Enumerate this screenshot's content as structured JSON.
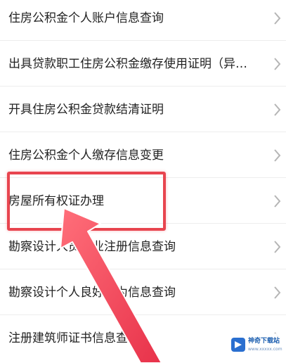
{
  "list": {
    "items": [
      {
        "label": "住房公积金个人账户信息查询"
      },
      {
        "label": "出具贷款职工住房公积金缴存使用证明（异…"
      },
      {
        "label": "开具住房公积金贷款结清证明"
      },
      {
        "label": "住房公积金个人缴存信息变更"
      },
      {
        "label": "房屋所有权证办理"
      },
      {
        "label": "勘察设计人员执业注册信息查询"
      },
      {
        "label": "勘察设计个人良好行为信息查询"
      },
      {
        "label": "注册建筑师证书信息查询"
      }
    ]
  },
  "icons": {
    "chevron": "chevron-right-icon",
    "pointer": "arrow-pointer-icon"
  },
  "watermark": {
    "text": "神奇下载站",
    "sub": "www.xxxxx.com"
  },
  "colors": {
    "highlight": "#e8454f",
    "text": "#222222",
    "chevron": "#b5b5b5"
  }
}
